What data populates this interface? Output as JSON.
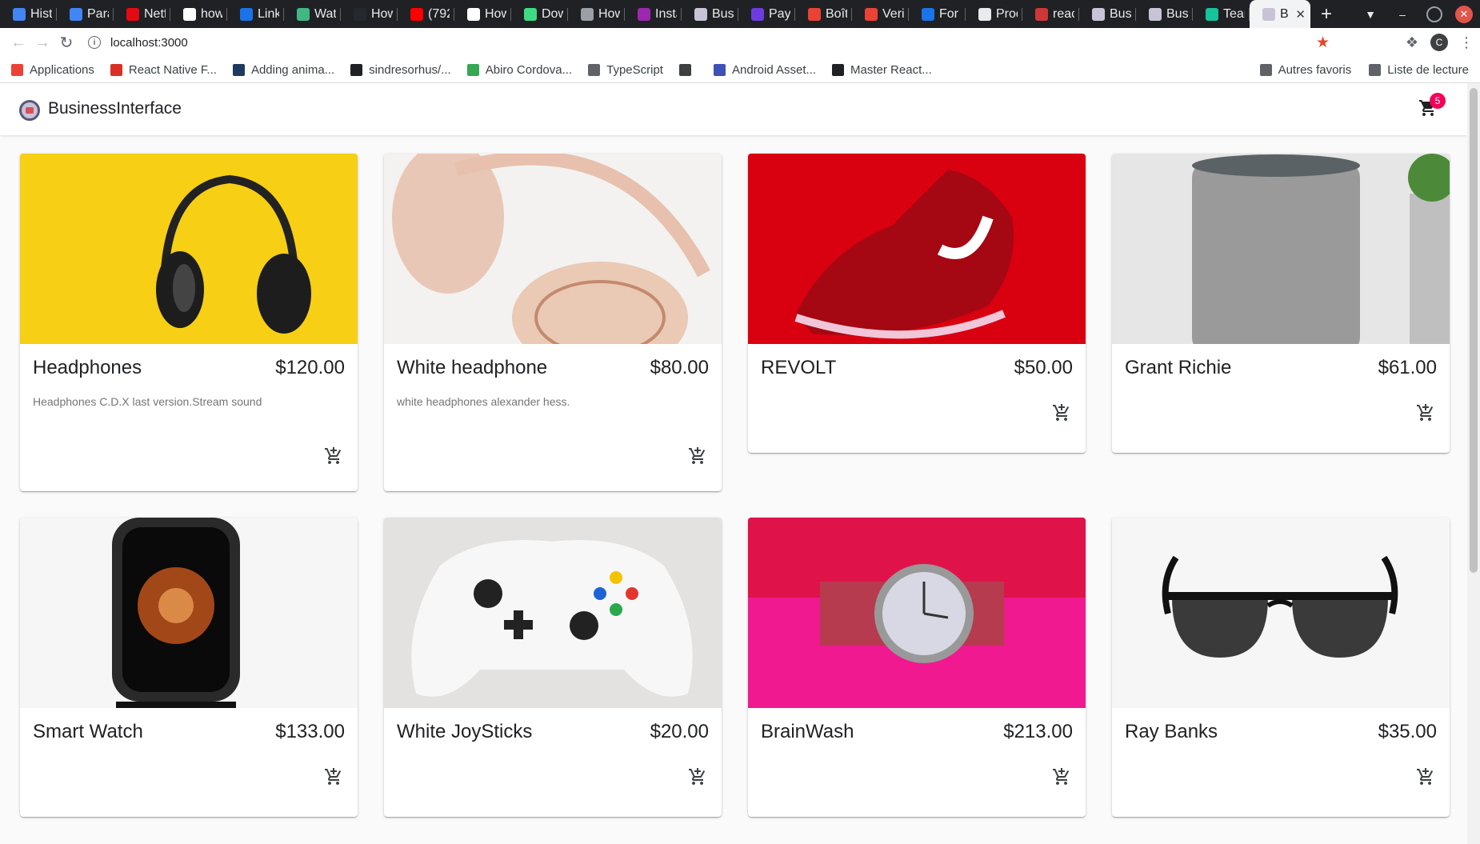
{
  "browser": {
    "tabs": [
      {
        "title": "Hist",
        "icon": "history-icon",
        "color": "#4285f4"
      },
      {
        "title": "Para",
        "icon": "gear-icon",
        "color": "#4285f4"
      },
      {
        "title": "Netf",
        "icon": "netflix-icon",
        "color": "#e50914"
      },
      {
        "title": "how",
        "icon": "google-icon",
        "color": "#ffffff"
      },
      {
        "title": "Link",
        "icon": "link-icon",
        "color": "#1a73e8"
      },
      {
        "title": "Wat",
        "icon": "vue-icon",
        "color": "#41b883"
      },
      {
        "title": "How",
        "icon": "hex-icon",
        "color": "#24292e"
      },
      {
        "title": "(792",
        "icon": "youtube-icon",
        "color": "#ff0000"
      },
      {
        "title": "How",
        "icon": "t-icon",
        "color": "#ffffff"
      },
      {
        "title": "Dow",
        "icon": "android-icon",
        "color": "#3ddc84"
      },
      {
        "title": "How",
        "icon": "globe-icon",
        "color": "#9aa0a6"
      },
      {
        "title": "Insta",
        "icon": "insta-icon",
        "color": "#9c27b0"
      },
      {
        "title": "Busi",
        "icon": "store-icon",
        "color": "#c9c3d8"
      },
      {
        "title": "Payr",
        "icon": "stripe-icon",
        "color": "#6c3ce1"
      },
      {
        "title": "Boît",
        "icon": "gmail-icon",
        "color": "#ea4335"
      },
      {
        "title": "Veri",
        "icon": "gmail-icon",
        "color": "#ea4335"
      },
      {
        "title": "For",
        "icon": "cloud-icon",
        "color": "#1a73e8"
      },
      {
        "title": "Prod",
        "icon": "cloud-icon",
        "color": "#e8eaed"
      },
      {
        "title": "reac",
        "icon": "npm-icon",
        "color": "#cb3837"
      },
      {
        "title": "Busi",
        "icon": "store-icon",
        "color": "#c9c3d8"
      },
      {
        "title": "Busi",
        "icon": "store-icon",
        "color": "#c9c3d8"
      },
      {
        "title": "Tear",
        "icon": "diamond-icon",
        "color": "#16c39b"
      },
      {
        "title": "B",
        "icon": "store-icon",
        "color": "#c9c3d8",
        "active": true
      }
    ],
    "url": "localhost:3000",
    "bookmarks": [
      {
        "label": "Applications",
        "icon": "apps-grid-icon",
        "color": "#ea4335"
      },
      {
        "label": "React Native F...",
        "icon": "flag-icon",
        "color": "#d93025"
      },
      {
        "label": "Adding anima...",
        "icon": "bookmark-icon",
        "color": "#1e3a5f"
      },
      {
        "label": "sindresorhus/...",
        "icon": "github-icon",
        "color": "#202124"
      },
      {
        "label": "Abiro Cordova...",
        "icon": "grid-icon",
        "color": "#34a853"
      },
      {
        "label": "TypeScript",
        "icon": "folder-icon",
        "color": "#5f6368"
      },
      {
        "label": "",
        "icon": "globe-icon",
        "color": "#3c4043"
      },
      {
        "label": "Android Asset...",
        "icon": "android-asset-icon",
        "color": "#3f51b5"
      },
      {
        "label": "Master React...",
        "icon": "terminal-icon",
        "color": "#202124"
      }
    ],
    "bookmarks_right": [
      {
        "label": "Autres favoris",
        "icon": "folder-icon"
      },
      {
        "label": "Liste de lecture",
        "icon": "reading-list-icon"
      }
    ],
    "profile_initial": "C"
  },
  "app": {
    "brand": "BusinessInterface",
    "cart_count": "5",
    "accent": "#f50057"
  },
  "products": [
    {
      "name": "Headphones",
      "price": "$120.00",
      "description": "Headphones C.D.X last version.Stream sound",
      "image": "black-headphones-on-yellow"
    },
    {
      "name": "White headphone",
      "price": "$80.00",
      "description": "white headphones alexander hess.",
      "image": "pink-headphones-on-white"
    },
    {
      "name": "REVOLT",
      "price": "$50.00",
      "description": "",
      "image": "red-sneaker-on-red"
    },
    {
      "name": "Grant Richie",
      "price": "$61.00",
      "description": "",
      "image": "grey-smart-speaker"
    },
    {
      "name": "Smart Watch",
      "price": "$133.00",
      "description": "",
      "image": "black-smart-watch"
    },
    {
      "name": "White JoySticks",
      "price": "$20.00",
      "description": "",
      "image": "white-game-controller"
    },
    {
      "name": "BrainWash",
      "price": "$213.00",
      "description": "",
      "image": "silver-wristwatch-on-pink"
    },
    {
      "name": "Ray Banks",
      "price": "$35.00",
      "description": "",
      "image": "black-sunglasses"
    }
  ]
}
